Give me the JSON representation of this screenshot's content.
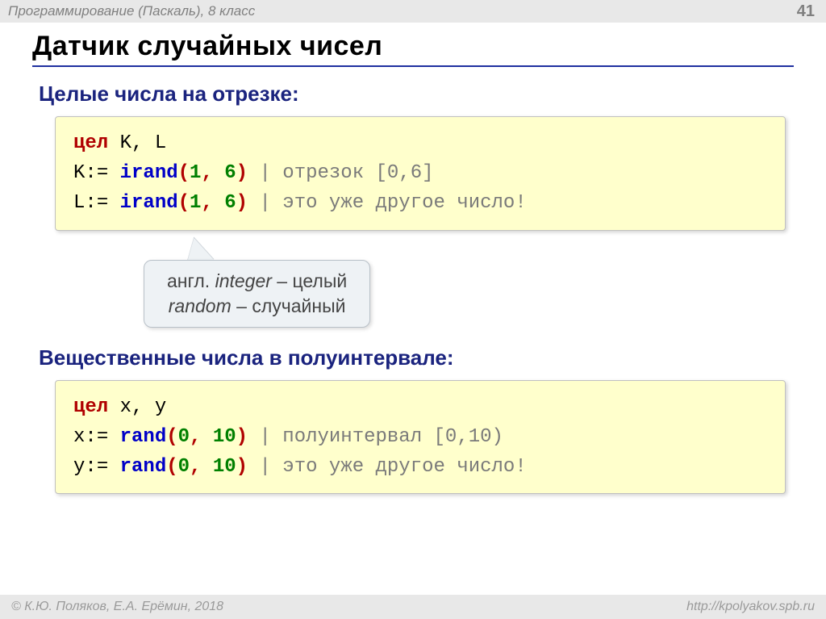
{
  "header": {
    "subject": "Программирование (Паскаль), 8 класс",
    "page": "41"
  },
  "title": "Датчик случайных чисел",
  "section1": {
    "heading": "Целые числа на отрезке:",
    "code": {
      "kw1": "цел",
      "decl": " K, L",
      "l2a": "K:",
      "l2b": "=",
      "func": "irand",
      "args_open": "(",
      "a1": "1",
      "comma": ",",
      "a2": "6",
      "args_close": ")",
      "cmt2": " | отрезок [0,6]",
      "l3a": "L:",
      "l3b": "=",
      "cmt3": " | это уже другое число!"
    }
  },
  "callout": {
    "line1a": "англ. ",
    "line1b": "integer",
    "line1c": " – целый",
    "line2a": "random",
    "line2b": " – случайный"
  },
  "section2": {
    "heading": "Вещественные числа в полуинтервале:",
    "code": {
      "kw1": "цел",
      "decl": " x, y",
      "l2a": "x:",
      "l2b": "=",
      "func": "rand",
      "args_open": "(",
      "a1": "0",
      "comma": ",",
      "a2": "10",
      "args_close": ")",
      "cmt2": " | полуинтервал [0,10)",
      "l3a": "y:",
      "l3b": "=",
      "cmt3": " | это уже другое число!"
    }
  },
  "footer": {
    "left": "© К.Ю. Поляков, Е.А. Ерёмин, 2018",
    "right": "http://kpolyakov.spb.ru"
  }
}
